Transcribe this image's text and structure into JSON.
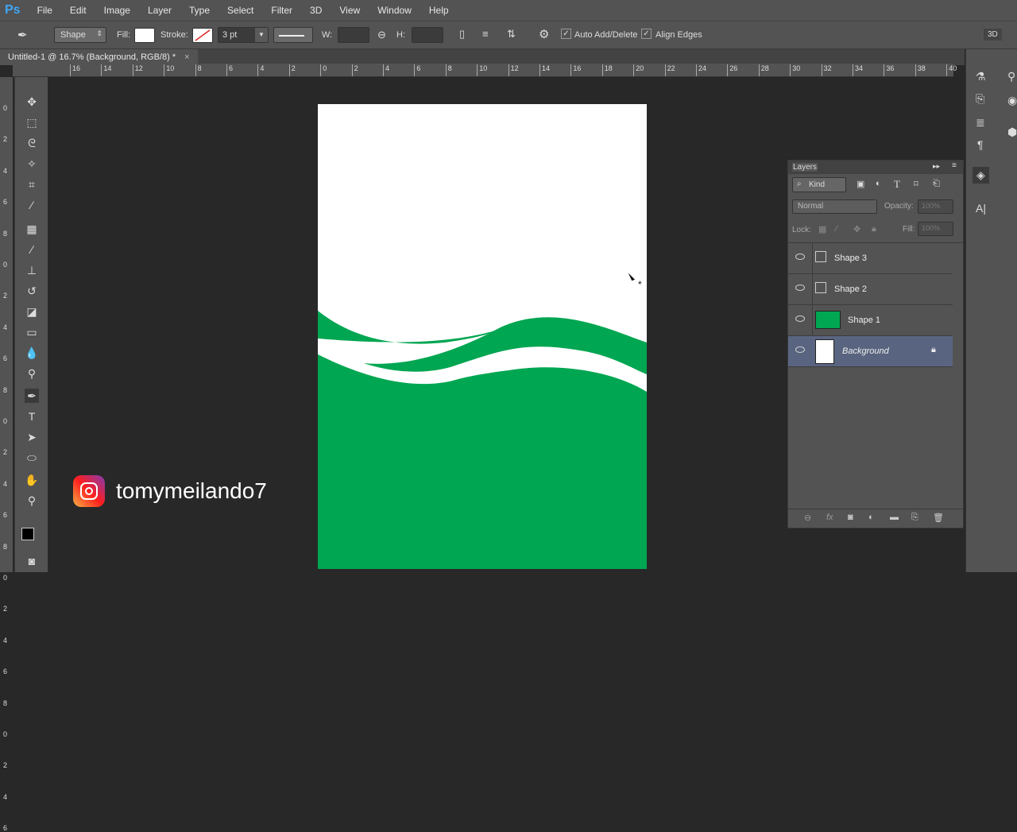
{
  "app": {
    "logo": "Ps"
  },
  "menu": [
    "File",
    "Edit",
    "Image",
    "Layer",
    "Type",
    "Select",
    "Filter",
    "3D",
    "View",
    "Window",
    "Help"
  ],
  "options": {
    "mode": "Shape",
    "fill_label": "Fill:",
    "stroke_label": "Stroke:",
    "stroke_width": "3 pt",
    "w_label": "W:",
    "h_label": "H:",
    "auto_add_delete": "Auto Add/Delete",
    "align_edges": "Align Edges",
    "workspace": "3D"
  },
  "document": {
    "tab_title": "Untitled-1 @ 16.7% (Background, RGB/8) *",
    "close": "×"
  },
  "ruler_top": [
    "16",
    "14",
    "12",
    "10",
    "8",
    "6",
    "4",
    "2",
    "0",
    "2",
    "4",
    "6",
    "8",
    "10",
    "12",
    "14",
    "16",
    "18",
    "20",
    "22",
    "24",
    "26",
    "28",
    "30",
    "32",
    "34",
    "36",
    "38",
    "40"
  ],
  "ruler_left": [
    "0",
    "2",
    "4",
    "6",
    "8",
    "0",
    "2",
    "4",
    "6",
    "8",
    "0",
    "2",
    "4",
    "6",
    "8",
    "0",
    "2",
    "4",
    "6",
    "8",
    "0",
    "2",
    "4",
    "6"
  ],
  "colors": {
    "green": "#00a651",
    "panel": "#535353",
    "selected_layer": "#596580"
  },
  "layers": {
    "title": "Layers",
    "filter": "Kind",
    "blend_mode": "Normal",
    "opacity_label": "Opacity:",
    "opacity": "100%",
    "lock_label": "Lock:",
    "fill_label": "Fill:",
    "fill": "100%",
    "items": [
      {
        "name": "Shape 3"
      },
      {
        "name": "Shape 2"
      },
      {
        "name": "Shape 1"
      },
      {
        "name": "Background"
      }
    ]
  },
  "watermark": {
    "handle": "tomymeilando7"
  }
}
